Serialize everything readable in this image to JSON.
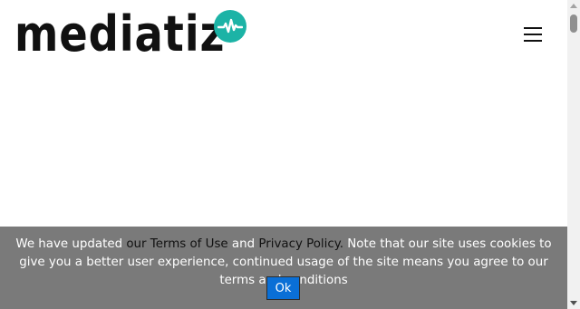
{
  "header": {
    "logo_text": "mediatiz",
    "logo_icon": "pulse-icon",
    "menu_icon": "hamburger-menu-icon"
  },
  "cookie_banner": {
    "text_before": "We have updated ",
    "terms_link": "our Terms of Use",
    "text_and": " and ",
    "privacy_link": "Privacy Policy.",
    "text_after": " Note that our site uses cookies to give you a better user experience, continued usage of the site means you agree to our terms and conditions",
    "ok_label": "Ok"
  },
  "colors": {
    "brand_teal": "#1cb3a6",
    "banner_bg": "#707070",
    "ok_button": "#0a6fd6"
  }
}
